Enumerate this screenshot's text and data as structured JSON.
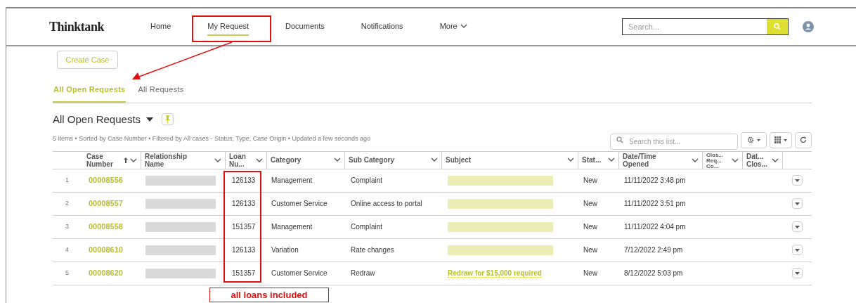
{
  "header": {
    "logo": "Thinktank",
    "nav": [
      {
        "label": "Home",
        "selected": false,
        "kind": "link"
      },
      {
        "label": "My Request",
        "selected": true,
        "kind": "link"
      },
      {
        "label": "Documents",
        "selected": false,
        "kind": "link"
      },
      {
        "label": "Notifications",
        "selected": false,
        "kind": "link"
      },
      {
        "label": "More",
        "selected": false,
        "kind": "menu"
      }
    ],
    "search": {
      "placeholder": "Search..."
    }
  },
  "create_button": "Create Case",
  "tabs": [
    {
      "label": "All Open Requests",
      "selected": true
    },
    {
      "label": "All Requests",
      "selected": false
    }
  ],
  "list": {
    "title": "All Open Requests",
    "meta": "5 items • Sorted by Case Number • Filtered by All cases - Status, Type, Case Origin • Updated a few seconds ago",
    "search": {
      "placeholder": "Search this list..."
    }
  },
  "table": {
    "columns": [
      {
        "label": [
          "Case",
          "Number"
        ],
        "sorted": true
      },
      {
        "label": [
          "Relationship",
          "Name"
        ],
        "sorted": false
      },
      {
        "label": [
          "Loan",
          "Nu..."
        ],
        "sorted": false
      },
      {
        "label": [
          "Category"
        ],
        "sorted": false
      },
      {
        "label": [
          "Sub Category"
        ],
        "sorted": false
      },
      {
        "label": [
          "Subject"
        ],
        "sorted": false
      },
      {
        "label": [
          "Stat..."
        ],
        "sorted": false
      },
      {
        "label": [
          "Date/Time",
          "Opened"
        ],
        "sorted": false
      },
      {
        "label": [
          "Clos...",
          "Req...",
          "Co..."
        ],
        "sorted": false
      },
      {
        "label": [
          "Dat...",
          "Clos..."
        ],
        "sorted": false
      }
    ],
    "rows": [
      {
        "index": "1",
        "case_number": "00008556",
        "relationship": {
          "kind": "redacted"
        },
        "loan": "126133",
        "category": "Management",
        "sub_category": "Complaint",
        "subject": {
          "kind": "redacted"
        },
        "status": "New",
        "opened": "11/11/2022 3:48 pm"
      },
      {
        "index": "2",
        "case_number": "00008557",
        "relationship": {
          "kind": "redacted"
        },
        "loan": "126133",
        "category": "Customer Service",
        "sub_category": "Online access to portal",
        "subject": {
          "kind": "redacted"
        },
        "status": "New",
        "opened": "11/11/2022 3:51 pm"
      },
      {
        "index": "3",
        "case_number": "00008558",
        "relationship": {
          "kind": "redacted"
        },
        "loan": "151357",
        "category": "Management",
        "sub_category": "Complaint",
        "subject": {
          "kind": "redacted"
        },
        "status": "New",
        "opened": "11/11/2022 4:04 pm"
      },
      {
        "index": "4",
        "case_number": "00008610",
        "relationship": {
          "kind": "redacted"
        },
        "loan": "126133",
        "category": "Variation",
        "sub_category": "Rate changes",
        "subject": {
          "kind": "redacted"
        },
        "status": "New",
        "opened": "7/12/2022 2:49 pm"
      },
      {
        "index": "5",
        "case_number": "00008620",
        "relationship": {
          "kind": "redacted"
        },
        "loan": "151357",
        "category": "Customer Service",
        "sub_category": "Redraw",
        "subject": {
          "kind": "link",
          "text": "Redraw for $15,000 required"
        },
        "status": "New",
        "opened": "8/12/2022 5:03 pm"
      }
    ]
  },
  "annotations": {
    "note": "all loans included"
  }
}
